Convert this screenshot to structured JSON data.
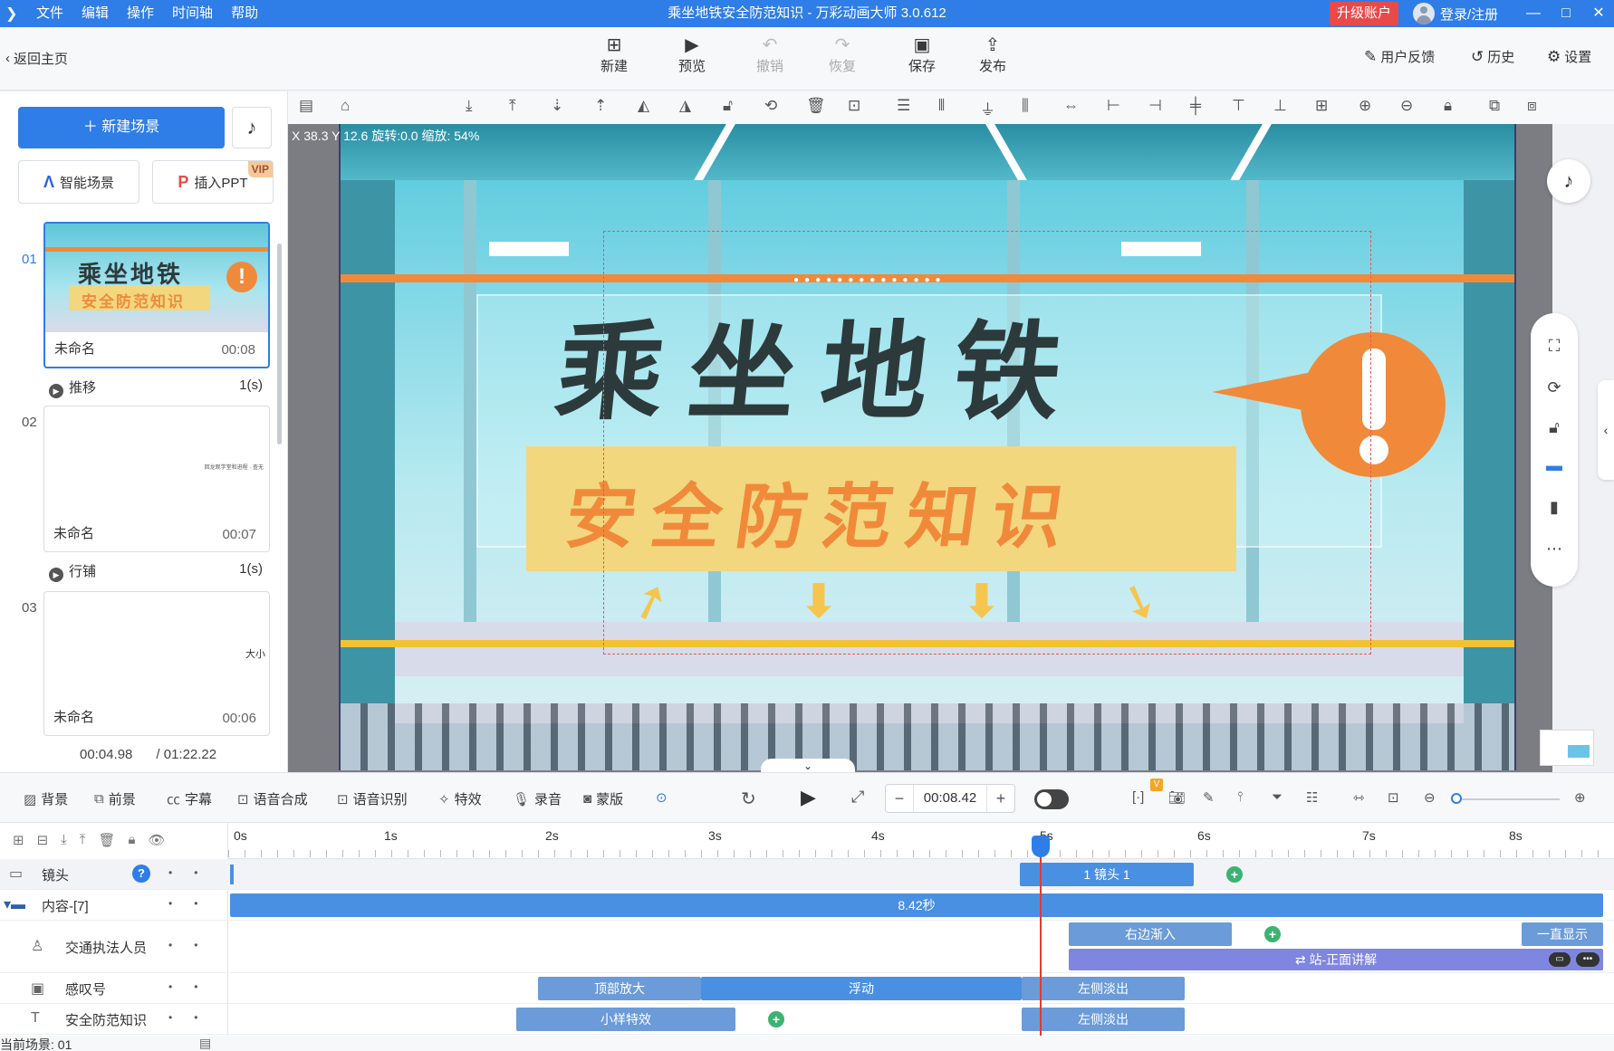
{
  "window": {
    "title": "乘坐地铁安全防范知识 - 万彩动画大师 3.0.612",
    "menu": [
      "文件",
      "编辑",
      "操作",
      "时间轴",
      "帮助"
    ],
    "upgrade_label": "升级账户",
    "login_label": "登录/注册",
    "controls": [
      "—",
      "□",
      "✕"
    ]
  },
  "toolbar": {
    "back_label": "返回主页",
    "buttons": {
      "new": "新建",
      "preview": "预览",
      "undo": "撤销",
      "redo": "恢复",
      "save": "保存",
      "publish": "发布"
    },
    "feedback_label": "用户反馈",
    "history_label": "历史",
    "settings_label": "设置"
  },
  "left_panel": {
    "new_scene_label": "新建场景",
    "smart_scene_label": "智能场景",
    "insert_ppt_label": "插入PPT",
    "vip_badge": "VIP",
    "scenes": [
      {
        "num": "01",
        "name": "未命名",
        "duration": "00:08",
        "thumb_title": "乘坐地铁",
        "thumb_subtitle": "安全防范知识"
      },
      {
        "num": "02",
        "name": "未命名",
        "duration": "00:07",
        "thumb_text": "回龙观学堂和进程 · 查无"
      },
      {
        "num": "03",
        "name": "未命名",
        "duration": "00:06",
        "thumb_text": "大小"
      }
    ],
    "transitions": [
      {
        "name": "推移",
        "duration": "1(s)"
      },
      {
        "name": "行铺",
        "duration": "1(s)"
      }
    ],
    "current_time": "00:04.98",
    "total_time": "/ 01:22.22"
  },
  "stage": {
    "coords_readout": "X 38.3  Y 12.6  旋转:0.0  缩放: 54%",
    "title_text": "乘坐地铁",
    "subtitle_text": "安全防范知识"
  },
  "bottom_toolbar": {
    "background_label": "背景",
    "foreground_label": "前景",
    "subtitle_label": "字幕",
    "tts_label": "语音合成",
    "asr_label": "语音识别",
    "effects_label": "特效",
    "record_label": "录音",
    "mask_label": "蒙版",
    "time_value": "00:08.42",
    "vip_badge": "V"
  },
  "timeline": {
    "ruler": [
      "0s",
      "1s",
      "2s",
      "3s",
      "4s",
      "5s",
      "6s",
      "7s",
      "8s"
    ],
    "rows": [
      {
        "name": "镜头"
      },
      {
        "name": "内容-[7]"
      },
      {
        "name": "交通执法人员"
      },
      {
        "name": "感叹号"
      },
      {
        "name": "安全防范知识"
      }
    ],
    "clips": {
      "camera": "1 镜头 1",
      "content": "8.42秒",
      "officer_in": "右边渐入",
      "officer_show": "一直显示",
      "officer_action": "⇄ 站-正面讲解",
      "excl_zoom": "顶部放大",
      "excl_float": "浮动",
      "excl_out": "左侧淡出",
      "safety_effect": "小样特效",
      "safety_out": "左侧淡出"
    },
    "current_scene": "当前场景: 01"
  },
  "colors": {
    "accent": "#2f7de6",
    "upgrade": "#e84a4a",
    "clip_blue": "#4a90e2",
    "clip_purple": "#7f86e0",
    "keyframe_green": "#3cb371",
    "playhead": "#e53935"
  }
}
